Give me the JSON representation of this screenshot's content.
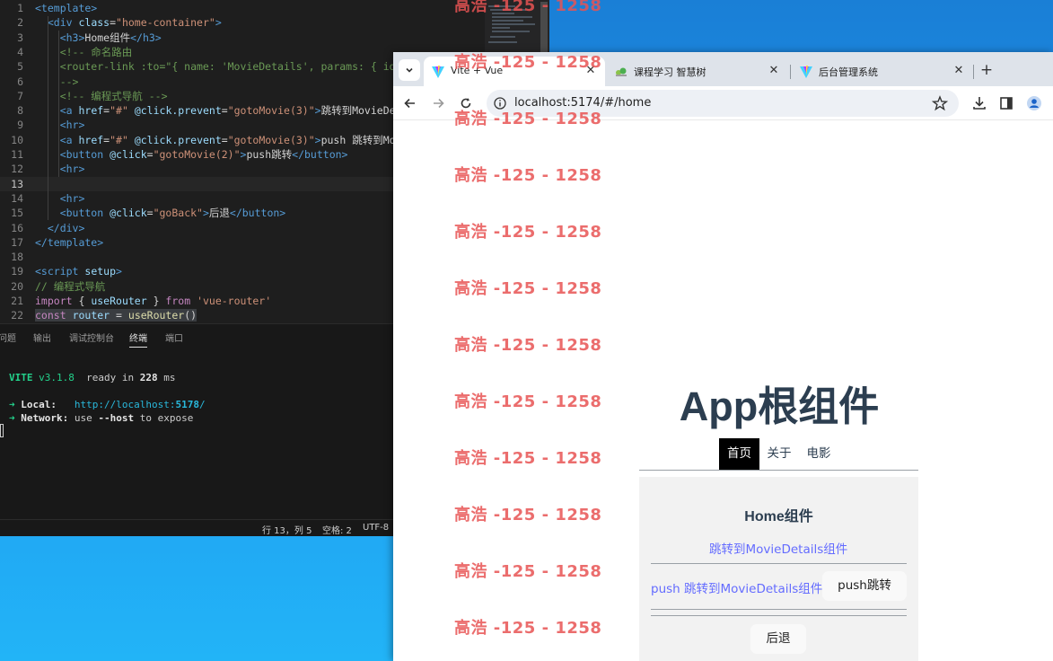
{
  "editor": {
    "code_lines": [
      {
        "n": "1",
        "parts": [
          [
            "c-tag",
            "<template>"
          ]
        ]
      },
      {
        "n": "2",
        "parts": [
          [
            "c-tag",
            "  <div "
          ],
          [
            "c-attr",
            "class"
          ],
          [
            "c-text",
            "="
          ],
          [
            "c-str",
            "\"home-container\""
          ],
          [
            "c-tag",
            ">"
          ]
        ]
      },
      {
        "n": "3",
        "parts": [
          [
            "c-tag",
            "    <h3>"
          ],
          [
            "c-text",
            "Home组件"
          ],
          [
            "c-tag",
            "</h3>"
          ]
        ]
      },
      {
        "n": "4",
        "parts": [
          [
            "c-com",
            "    <!-- 命名路由"
          ]
        ]
      },
      {
        "n": "5",
        "parts": [
          [
            "c-com",
            "    <router-link :to=\"{ name: 'MovieDetails', params: { id:"
          ]
        ]
      },
      {
        "n": "6",
        "parts": [
          [
            "c-com",
            "    -->"
          ]
        ]
      },
      {
        "n": "7",
        "parts": [
          [
            "c-com",
            "    <!-- 编程式导航 -->"
          ]
        ]
      },
      {
        "n": "8",
        "parts": [
          [
            "c-tag",
            "    <a "
          ],
          [
            "c-attr",
            "href"
          ],
          [
            "c-text",
            "="
          ],
          [
            "c-str",
            "\"#\""
          ],
          [
            "c-text",
            " "
          ],
          [
            "c-attr",
            "@click.prevent"
          ],
          [
            "c-text",
            "="
          ],
          [
            "c-str",
            "\"gotoMovie(3)\""
          ],
          [
            "c-tag",
            ">"
          ],
          [
            "c-text",
            "跳转到MovieDeta"
          ]
        ]
      },
      {
        "n": "9",
        "parts": [
          [
            "c-tag",
            "    <hr>"
          ]
        ]
      },
      {
        "n": "10",
        "parts": [
          [
            "c-tag",
            "    <a "
          ],
          [
            "c-attr",
            "href"
          ],
          [
            "c-text",
            "="
          ],
          [
            "c-str",
            "\"#\""
          ],
          [
            "c-text",
            " "
          ],
          [
            "c-attr",
            "@click.prevent"
          ],
          [
            "c-text",
            "="
          ],
          [
            "c-str",
            "\"gotoMovie(3)\""
          ],
          [
            "c-tag",
            ">"
          ],
          [
            "c-text",
            "push 跳转到Movi"
          ]
        ]
      },
      {
        "n": "11",
        "parts": [
          [
            "c-tag",
            "    <button "
          ],
          [
            "c-attr",
            "@click"
          ],
          [
            "c-text",
            "="
          ],
          [
            "c-str",
            "\"gotoMovie(2)\""
          ],
          [
            "c-tag",
            ">"
          ],
          [
            "c-text",
            "push跳转"
          ],
          [
            "c-tag",
            "</button>"
          ]
        ]
      },
      {
        "n": "12",
        "parts": [
          [
            "c-tag",
            "    <hr>"
          ]
        ]
      },
      {
        "n": "13",
        "parts": [
          [
            "c-text",
            ""
          ]
        ]
      },
      {
        "n": "14",
        "parts": [
          [
            "c-tag",
            "    <hr>"
          ]
        ]
      },
      {
        "n": "15",
        "parts": [
          [
            "c-tag",
            "    <button "
          ],
          [
            "c-attr",
            "@click"
          ],
          [
            "c-text",
            "="
          ],
          [
            "c-str",
            "\"goBack\""
          ],
          [
            "c-tag",
            ">"
          ],
          [
            "c-text",
            "后退"
          ],
          [
            "c-tag",
            "</button>"
          ]
        ]
      },
      {
        "n": "16",
        "parts": [
          [
            "c-tag",
            "  </div>"
          ]
        ]
      },
      {
        "n": "17",
        "parts": [
          [
            "c-tag",
            "</template>"
          ]
        ]
      },
      {
        "n": "18",
        "parts": [
          [
            "c-text",
            ""
          ]
        ]
      },
      {
        "n": "19",
        "parts": [
          [
            "c-tag",
            "<script "
          ],
          [
            "c-attr",
            "setup"
          ],
          [
            "c-tag",
            ">"
          ]
        ]
      },
      {
        "n": "20",
        "parts": [
          [
            "c-com",
            "// 编程式导航"
          ]
        ]
      },
      {
        "n": "21",
        "parts": [
          [
            "c-kw",
            "import"
          ],
          [
            "c-text",
            " { "
          ],
          [
            "c-var",
            "useRouter"
          ],
          [
            "c-text",
            " } "
          ],
          [
            "c-kw",
            "from"
          ],
          [
            "c-text",
            " "
          ],
          [
            "c-str",
            "'vue-router'"
          ]
        ]
      },
      {
        "n": "22",
        "parts": [
          [
            "c-kw",
            "const"
          ],
          [
            "c-text",
            " "
          ],
          [
            "c-var",
            "router"
          ],
          [
            "c-text",
            " = "
          ],
          [
            "c-fn",
            "useRouter"
          ],
          [
            "c-text",
            "()"
          ]
        ]
      }
    ],
    "panel_tabs": [
      "问题",
      "输出",
      "调试控制台",
      "终端",
      "端口"
    ],
    "active_panel_tab": "终端",
    "terminal": {
      "vite_label": "VITE",
      "vite_version": "v3.1.8",
      "ready_text": "ready in",
      "ready_ms": "228",
      "ms_unit": "ms",
      "arrow": "➜",
      "local_label": "Local:",
      "local_url_prefix": "http://localhost:",
      "local_url_port": "5178",
      "local_url_suffix": "/",
      "network_label": "Network:",
      "network_text_1": "use",
      "network_flag": "--host",
      "network_text_2": "to expose"
    },
    "status": {
      "position": "行 13，列 5",
      "spaces": "空格: 2",
      "encoding": "UTF-8"
    }
  },
  "browser": {
    "tabs": [
      {
        "label": "Vite + Vue",
        "active": true
      },
      {
        "label": "课程学习 智慧树",
        "active": false
      },
      {
        "label": "后台管理系统",
        "active": false
      }
    ],
    "url": "localhost:5174/#/home",
    "page": {
      "app_title": "App根组件",
      "nav": [
        "首页",
        "关于",
        "电影"
      ],
      "home_title": "Home组件",
      "link1": "跳转到MovieDetails组件",
      "link2": "push 跳转到MovieDetails组件",
      "push_button": "push跳转",
      "back_button": "后退"
    }
  },
  "watermark": "高浩 -125 - 1258",
  "colors": {
    "accent_link": "#646cff",
    "title": "#2c3e50",
    "watermark": "#e85454"
  }
}
